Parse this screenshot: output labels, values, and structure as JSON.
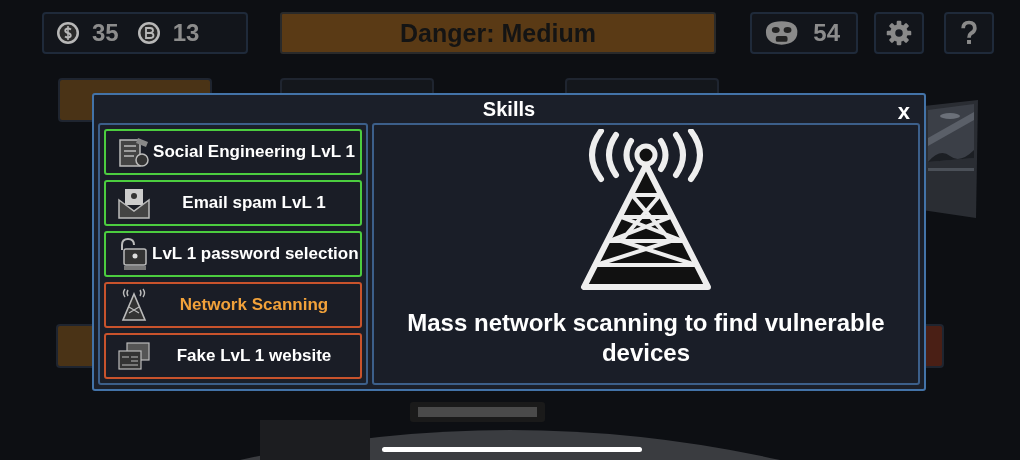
{
  "resources": {
    "coins": "35",
    "bitcoin": "13",
    "reputation": "54"
  },
  "danger": {
    "label": "Danger: Medium"
  },
  "skills_dialog": {
    "title": "Skills",
    "close": "x",
    "skills": [
      {
        "name": "Social Engineering LvL 1",
        "unlocked": true,
        "selected": false
      },
      {
        "name": "Email spam LvL 1",
        "unlocked": true,
        "selected": false
      },
      {
        "name": "LvL 1 password selection",
        "unlocked": true,
        "selected": false
      },
      {
        "name": "Network Scanning",
        "unlocked": false,
        "selected": true
      },
      {
        "name": "Fake LvL 1 website",
        "unlocked": false,
        "selected": false
      }
    ],
    "description": "Mass network scanning to find vulnerable devices"
  }
}
